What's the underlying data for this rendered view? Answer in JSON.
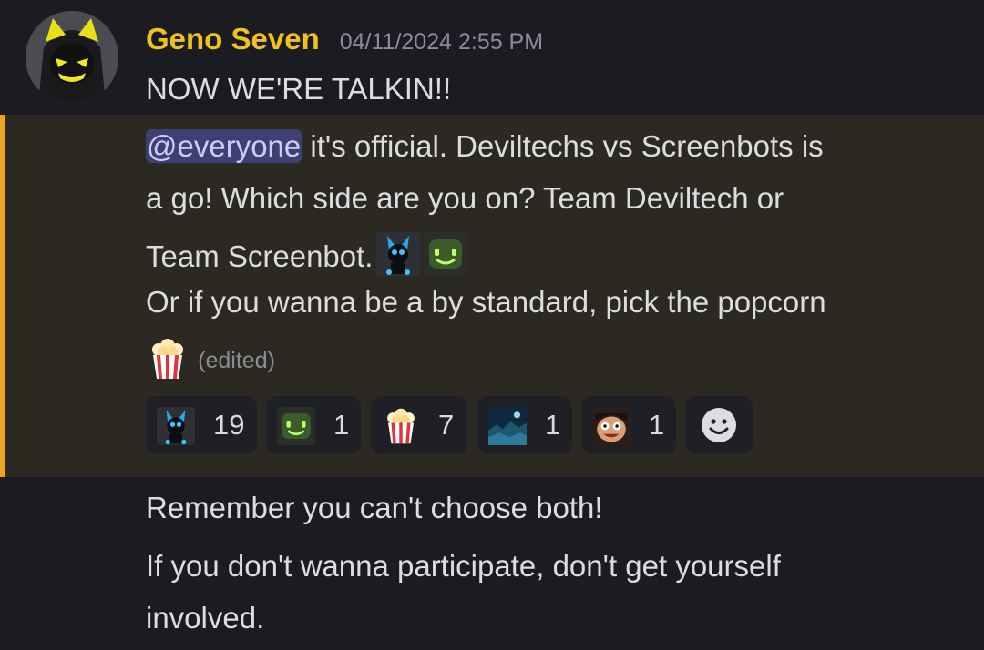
{
  "message": {
    "author": "Geno Seven",
    "timestamp": "04/11/2024 2:55 PM",
    "first_line": "NOW WE'RE TALKIN!!",
    "mention": "@everyone",
    "line1_rest": " it's official. Deviltechs vs Screenbots is",
    "line2": "a go! Which side are you on? Team Deviltech or",
    "line3": "Team Screenbot.",
    "line4": "Or if you wanna be a by standard, pick the popcorn",
    "edited": "(edited)",
    "after_1": "Remember you can't choose both!",
    "after_2": "If you don't wanna participate, don't get yourself",
    "after_3": "involved."
  },
  "reactions": [
    {
      "emoji": "deviltech-emoji",
      "count": "19"
    },
    {
      "emoji": "screenbot-emoji",
      "count": "1"
    },
    {
      "emoji": "popcorn-emoji",
      "count": "7"
    },
    {
      "emoji": "night-scene-emoji",
      "count": "1"
    },
    {
      "emoji": "face-emoji",
      "count": "1"
    }
  ],
  "add_reaction_icon": "smile-icon",
  "colors": {
    "background": "#1b1c21",
    "highlight_background": "#2c2922",
    "highlight_bar": "#eba824",
    "username": "#f0c21b",
    "mention_bg": "#3d4070",
    "mention_text": "#c9cdfb",
    "muted": "#8b8d94"
  }
}
